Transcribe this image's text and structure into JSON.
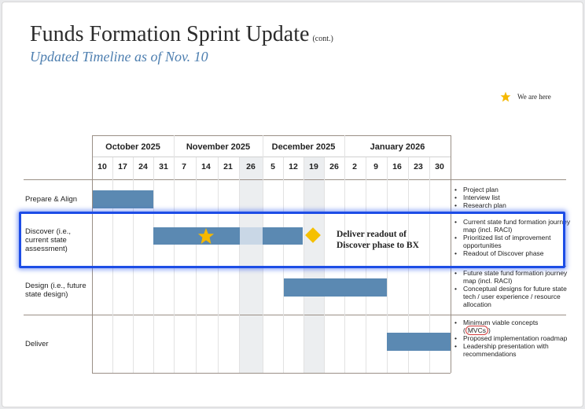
{
  "header": {
    "title": "Funds Formation Sprint Update",
    "title_suffix": "(cont.)",
    "subtitle": "Updated Timeline as of Nov. 10"
  },
  "legend": {
    "icon": "star-icon",
    "label": "We are here",
    "color": "#f5b800"
  },
  "timeline": {
    "months": [
      "October 2025",
      "November 2025",
      "December 2025",
      "January 2026"
    ],
    "weeks": [
      "10",
      "17",
      "24",
      "31",
      "7",
      "14",
      "21",
      "26",
      "5",
      "12",
      "19",
      "26",
      "2",
      "9",
      "16",
      "23",
      "30"
    ]
  },
  "phases": [
    {
      "label": "Prepare & Align",
      "notes": [
        "Project plan",
        "Interview list",
        "Research plan"
      ]
    },
    {
      "label": "Discover (i.e., current state assessment)",
      "notes": [
        "Current state fund formation journey map (incl. RACI)",
        "Prioritized list of improvement opportunities",
        "Readout of Discover phase"
      ]
    },
    {
      "label": "Design (i.e., future state design)",
      "notes": [
        "Future state fund formation journey map (incl. RACI)",
        "Conceptual designs for future state tech / user experience / resource allocation"
      ]
    },
    {
      "label": "Deliver",
      "notes_prefix": "Minimum viable concepts",
      "notes_circled": "MVCs",
      "notes": [
        "Proposed implementation roadmap",
        "Leadership presentation with recommendations"
      ]
    }
  ],
  "milestone": {
    "icon": "diamond-icon",
    "label_line1": "Deliver readout of",
    "label_line2": "Discover phase to BX",
    "color": "#f5c000"
  },
  "colors": {
    "bar": "#5b89b2",
    "bar_light": "#c9d7e6",
    "highlight": "#1d4de6",
    "subtitle": "#4e7fb0"
  }
}
